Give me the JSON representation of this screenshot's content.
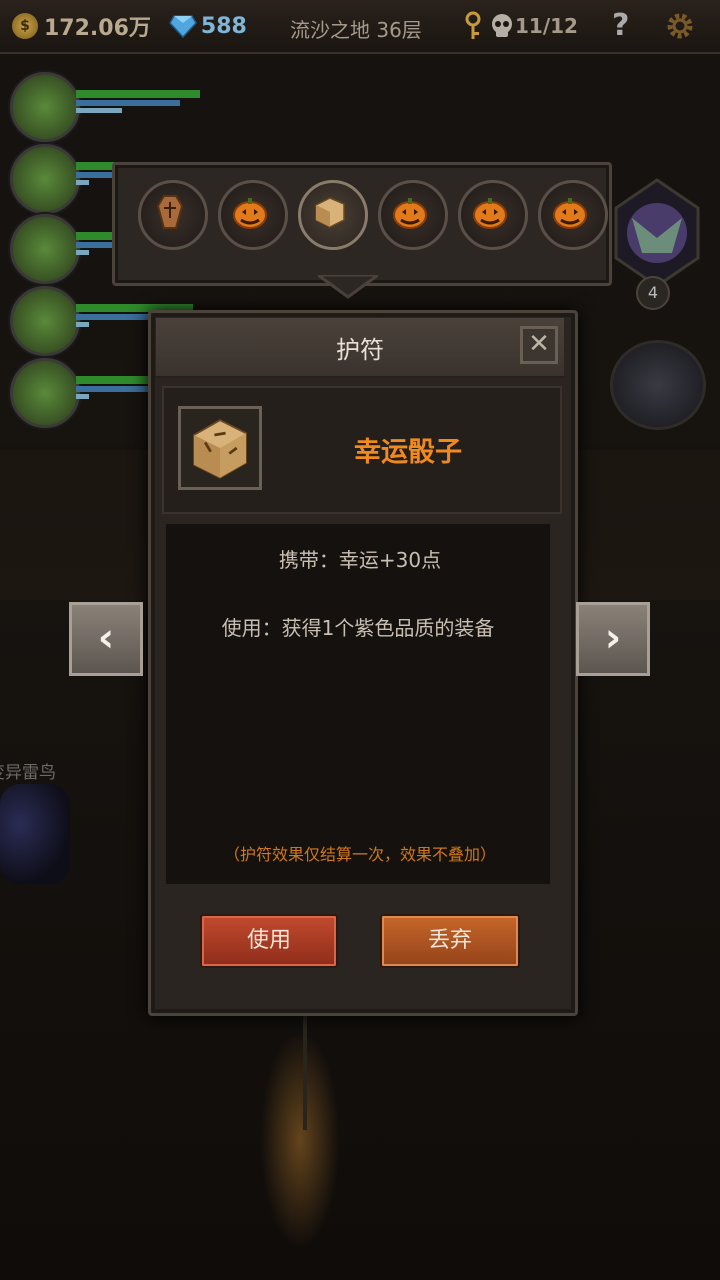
{
  "status_bar": {
    "coin_symbol": "$",
    "gold": "172.06万",
    "gems": "588",
    "location": "流沙之地 36层",
    "progress": "11/12",
    "help_symbol": "?"
  },
  "heroes": [
    {
      "hp": 0.95,
      "mp": 0.8,
      "xp": 0.35
    },
    {
      "hp": 0.9,
      "mp": 0.85,
      "xp": 0.1
    },
    {
      "hp": 0.85,
      "mp": 0.75,
      "xp": 0.1
    },
    {
      "hp": 0.9,
      "mp": 0.8,
      "xp": 0.1
    },
    {
      "hp": 0.85,
      "mp": 0.7,
      "xp": 0.1
    }
  ],
  "side": {
    "level": "4"
  },
  "enemy": {
    "name": "变异雷鸟"
  },
  "rune_slots": [
    {
      "icon": "coffin-icon",
      "active": false
    },
    {
      "icon": "pumpkin-icon",
      "active": false
    },
    {
      "icon": "dice-icon",
      "active": true
    },
    {
      "icon": "pumpkin-icon",
      "active": false
    },
    {
      "icon": "pumpkin-icon",
      "active": false
    },
    {
      "icon": "pumpkin-icon",
      "active": false
    }
  ],
  "dialog": {
    "title": "护符",
    "close_symbol": "✕",
    "item_name": "幸运骰子",
    "carry_effect": "携带：幸运+30点",
    "use_effect": "使用：获得1个紫色品质的装备",
    "note": "（护符效果仅结算一次，效果不叠加）",
    "use_label": "使用",
    "discard_label": "丢弃",
    "prev_symbol": "‹",
    "next_symbol": "›"
  },
  "colors": {
    "accent": "#f08a1e",
    "use_button": "#b03c25",
    "discard_button": "#bc5b24"
  }
}
